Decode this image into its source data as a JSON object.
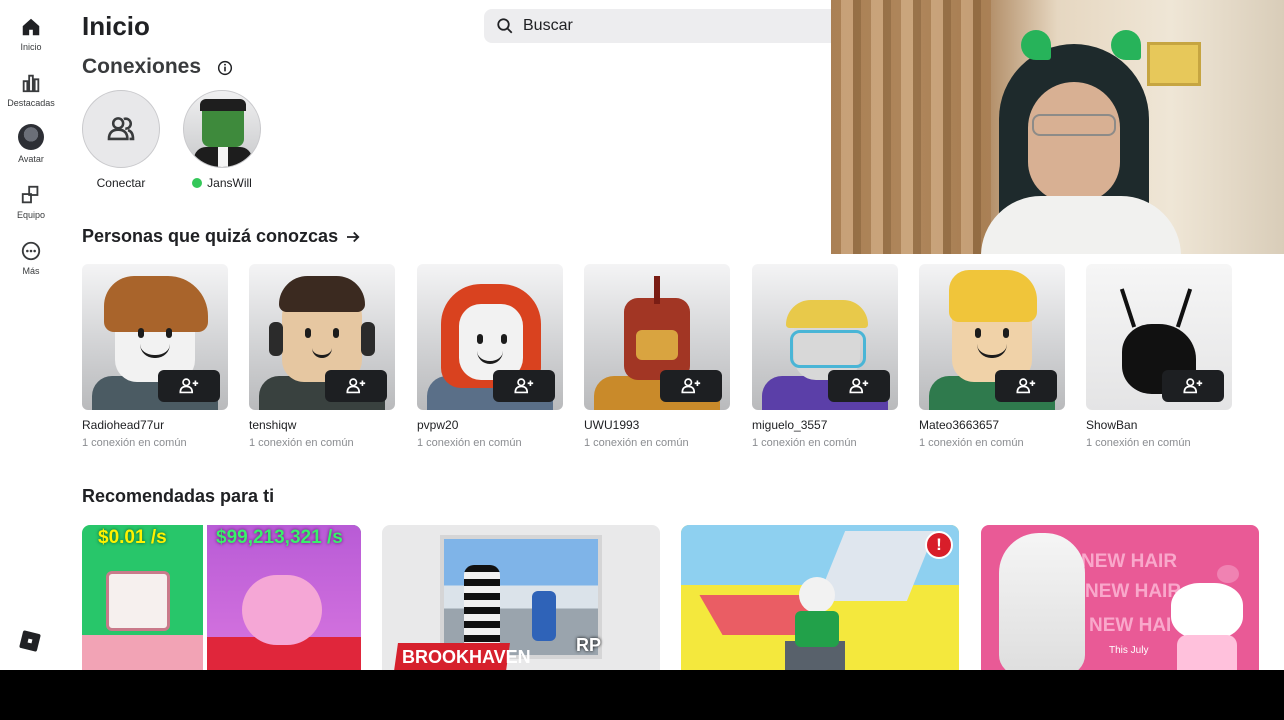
{
  "nav": [
    {
      "label": "Inicio",
      "icon": "home-icon"
    },
    {
      "label": "Destacadas",
      "icon": "chart-icon"
    },
    {
      "label": "Avatar",
      "icon": "avatar-icon"
    },
    {
      "label": "Equipo",
      "icon": "inventory-icon"
    },
    {
      "label": "Más",
      "icon": "more-icon"
    }
  ],
  "page": {
    "title": "Inicio"
  },
  "search": {
    "placeholder": "Buscar"
  },
  "connections": {
    "title": "Conexiones",
    "items": [
      {
        "name": "Conectar",
        "online": false
      },
      {
        "name": "JansWill",
        "online": true
      }
    ]
  },
  "people": {
    "title": "Personas que quizá conozcas",
    "items": [
      {
        "name": "Radiohead77ur",
        "mutual": "1 conexión en común"
      },
      {
        "name": "tenshiqw",
        "mutual": "1 conexión en común"
      },
      {
        "name": "pvpw20",
        "mutual": "1 conexión en común"
      },
      {
        "name": "UWU1993",
        "mutual": "1 conexión en común"
      },
      {
        "name": "miguelo_3557",
        "mutual": "1 conexión en común"
      },
      {
        "name": "Mateo3663657",
        "mutual": "1 conexión en común"
      },
      {
        "name": "ShowBan",
        "mutual": "1 conexión en común"
      }
    ]
  },
  "recommended": {
    "title": "Recomendadas para ti",
    "items": [
      {
        "texts": [
          "$0.01 /s",
          "$99,213,321 /s"
        ]
      },
      {
        "texts": [
          "BROOKHAVEN",
          "RP"
        ]
      },
      {
        "texts": [
          "!"
        ]
      },
      {
        "texts": [
          "NEW HAIR",
          "NEW HAIR",
          "NEW HAI",
          "This July"
        ]
      }
    ]
  },
  "colors": {
    "accent_online": "#34c759",
    "button_dark": "#1d1f22",
    "pink": "#e8508f"
  }
}
